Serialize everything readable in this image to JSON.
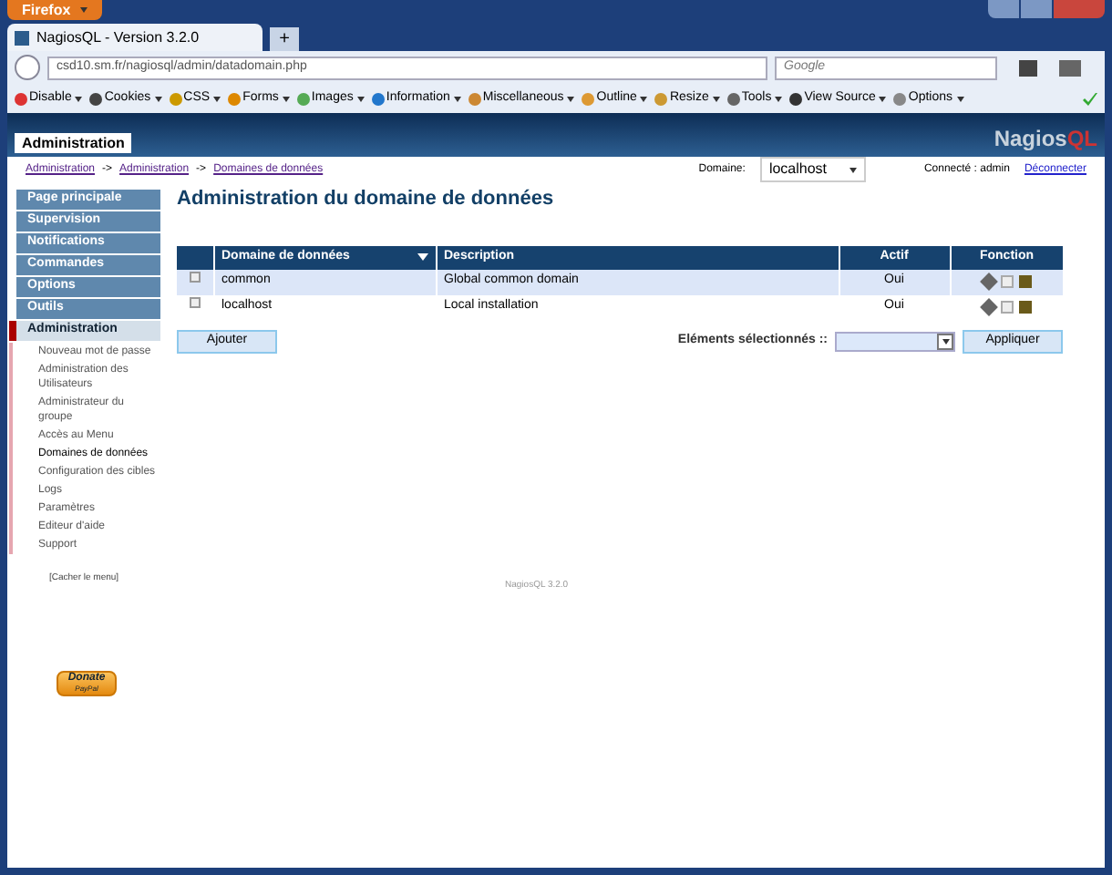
{
  "browser": {
    "app_button": "Firefox",
    "tab_title": "NagiosQL - Version 3.2.0",
    "new_tab": "+",
    "url": "csd10.sm.fr/nagiosql/admin/datadomain.php",
    "search_placeholder": "Google"
  },
  "toolbar": [
    "Disable",
    "Cookies",
    "CSS",
    "Forms",
    "Images",
    "Information",
    "Miscellaneous",
    "Outline",
    "Resize",
    "Tools",
    "View Source",
    "Options"
  ],
  "header": {
    "tab": "Administration",
    "logo_a": "Nagios",
    "logo_b": "QL"
  },
  "breadcrumbs": [
    "Administration",
    "Administration",
    "Domaines de données"
  ],
  "breadcrumb_sep": "->",
  "domain": {
    "label": "Domaine:",
    "value": "localhost"
  },
  "user": {
    "text": "Connecté : admin",
    "logout": "Déconnecter"
  },
  "menu": [
    {
      "label": "Page principale",
      "selected": false
    },
    {
      "label": "Supervision",
      "selected": false
    },
    {
      "label": "Notifications",
      "selected": false
    },
    {
      "label": "Commandes",
      "selected": false
    },
    {
      "label": "Options",
      "selected": false
    },
    {
      "label": "Outils",
      "selected": false
    },
    {
      "label": "Administration",
      "selected": true,
      "children": [
        {
          "label": "Nouveau mot de passe",
          "selected": false
        },
        {
          "label": "Administration des Utilisateurs",
          "selected": false
        },
        {
          "label": "Administrateur du groupe",
          "selected": false
        },
        {
          "label": "Accès au Menu",
          "selected": false
        },
        {
          "label": "Domaines de données",
          "selected": true
        },
        {
          "label": "Configuration des cibles",
          "selected": false
        },
        {
          "label": "Logs",
          "selected": false
        },
        {
          "label": "Paramètres",
          "selected": false
        },
        {
          "label": "Editeur d'aide",
          "selected": false
        },
        {
          "label": "Support",
          "selected": false
        }
      ]
    }
  ],
  "hide_menu": "[Cacher le menu]",
  "title": "Administration du domaine de données",
  "table": {
    "columns": [
      "Domaine de données",
      "Description",
      "Actif",
      "Fonction"
    ],
    "rows": [
      {
        "checked": false,
        "domain": "common",
        "description": "Global common domain",
        "active": "Oui"
      },
      {
        "checked": false,
        "domain": "localhost",
        "description": "Local installation",
        "active": "Oui"
      }
    ]
  },
  "add_button": "Ajouter",
  "selected_label": "Eléments sélectionnés ::",
  "apply_button": "Appliquer",
  "footer": "NagiosQL 3.2.0",
  "donate": {
    "label": "Donate",
    "sub": "PayPal"
  }
}
